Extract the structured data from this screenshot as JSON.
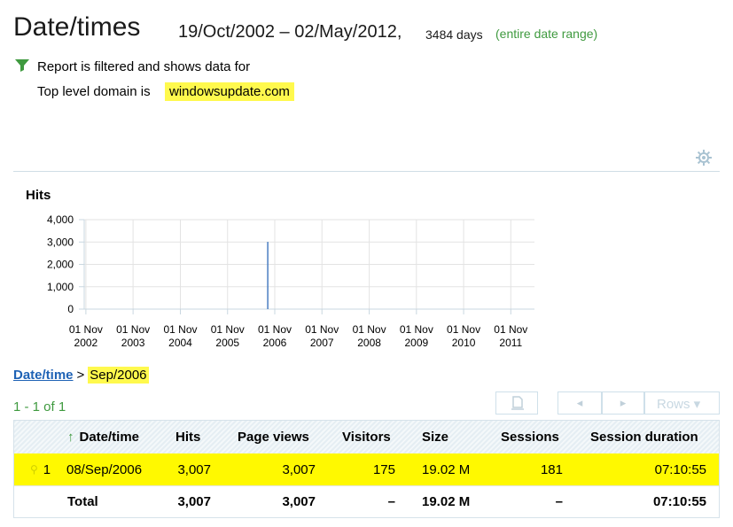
{
  "header": {
    "title": "Date/times",
    "range": "19/Oct/2002 – 02/May/2012,",
    "days": "3484 days",
    "entire_range_link": "(entire date range)"
  },
  "filter": {
    "line1": "Report is filtered and shows data for",
    "line2": "Top level domain is",
    "value": "windowsupdate.com"
  },
  "chart_data": {
    "type": "bar",
    "title": "Hits",
    "x_tick_labels": [
      [
        "01 Nov",
        "2002"
      ],
      [
        "01 Nov",
        "2003"
      ],
      [
        "01 Nov",
        "2004"
      ],
      [
        "01 Nov",
        "2005"
      ],
      [
        "01 Nov",
        "2006"
      ],
      [
        "01 Nov",
        "2007"
      ],
      [
        "01 Nov",
        "2008"
      ],
      [
        "01 Nov",
        "2009"
      ],
      [
        "01 Nov",
        "2010"
      ],
      [
        "01 Nov",
        "2011"
      ]
    ],
    "x_ticks": [
      "2002-11-01",
      "2003-11-01",
      "2004-11-01",
      "2005-11-01",
      "2006-11-01",
      "2007-11-01",
      "2008-11-01",
      "2009-11-01",
      "2010-11-01",
      "2011-11-01"
    ],
    "xlim": [
      "2002-10-19",
      "2012-05-02"
    ],
    "y_ticks": [
      "4,000",
      "3,000",
      "2,000",
      "1,000",
      "0"
    ],
    "y_tick_values": [
      4000,
      3000,
      2000,
      1000,
      0
    ],
    "ylim": [
      0,
      4000
    ],
    "grid": true,
    "points": [
      {
        "date": "2006-09-08",
        "value": 3007
      }
    ],
    "color": "#4a7ec2"
  },
  "breadcrumb": {
    "link": "Date/time",
    "separator": ">",
    "current": "Sep/2006"
  },
  "pager": {
    "count": "1 - 1 of 1",
    "rows_label": "Rows ▾"
  },
  "table": {
    "columns": [
      "Date/time",
      "Hits",
      "Page views",
      "Visitors",
      "Size",
      "Sessions",
      "Session duration"
    ],
    "sort_arrow": "↑",
    "rows": [
      {
        "index": "1",
        "date": "08/Sep/2006",
        "hits": "3,007",
        "page_views": "3,007",
        "visitors": "175",
        "size": "19.02 M",
        "sessions": "181",
        "duration": "07:10:55"
      }
    ],
    "total": {
      "label": "Total",
      "hits": "3,007",
      "page_views": "3,007",
      "visitors": "–",
      "size": "19.02 M",
      "sessions": "–",
      "duration": "07:10:55"
    }
  },
  "colors": {
    "highlight": "#fff900",
    "link_green": "#3f9a3f",
    "link_blue": "#1e62b5",
    "bar": "#4a7ec2"
  }
}
